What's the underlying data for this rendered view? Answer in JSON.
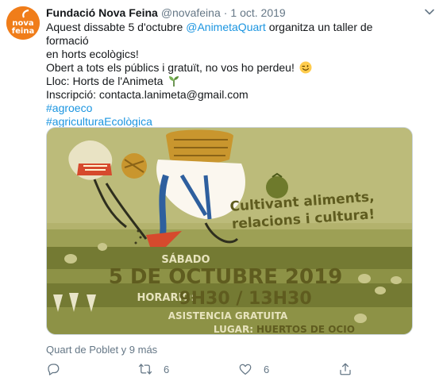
{
  "tweet": {
    "author_name": "Fundació Nova Feina",
    "handle": "@novafeina",
    "separator": "·",
    "date": "1 oct. 2019",
    "avatar_text_top": "nova",
    "avatar_text_bottom": "feina",
    "lines": {
      "l1_pre": "Aquest dissabte 5 d'octubre ",
      "l1_mention": "@AnimetaQuart",
      "l1_post": " organitza un taller de formació",
      "l2": "en horts ecològics!",
      "l3": "Obert a tots els públics i gratuït, no vos ho perdeu!",
      "l4": "Lloc: Horts de l'Animeta",
      "l5": "Inscripció: contacta.lanimeta@gmail.com",
      "hashtag1": "#agroeco",
      "hashtag2": "#agriculturaEcològica"
    },
    "emoji_names": [
      "winking-face-emoji",
      "seedling-emoji"
    ]
  },
  "poster": {
    "slogan_line1": "Cultivant aliments,",
    "slogan_line2": "relacions i cultura!",
    "day": "SÁBADO",
    "date": "5 DE OCTUBRE 2019",
    "horario_label": "HORARIO:",
    "horario_value": "9H30 / 13H30",
    "asistencia": "ASISTENCIA GRATUITA",
    "lugar_label": "LUGAR:",
    "lugar_value": "HUERTOS DE OCIO",
    "colors": {
      "background": "#b1b06a",
      "text": "#5f5c1f",
      "field_dark": "#747a33"
    }
  },
  "location": "Quart de Poblet y 9 más",
  "actions": {
    "reply_count": "",
    "retweet_count": "6",
    "like_count": "6"
  },
  "colors": {
    "link": "#1b95e0",
    "secondary_text": "#657786",
    "brand_orange": "#f07d1a"
  },
  "icons": [
    "chevron-down-icon",
    "reply-icon",
    "retweet-icon",
    "like-icon",
    "share-icon"
  ]
}
